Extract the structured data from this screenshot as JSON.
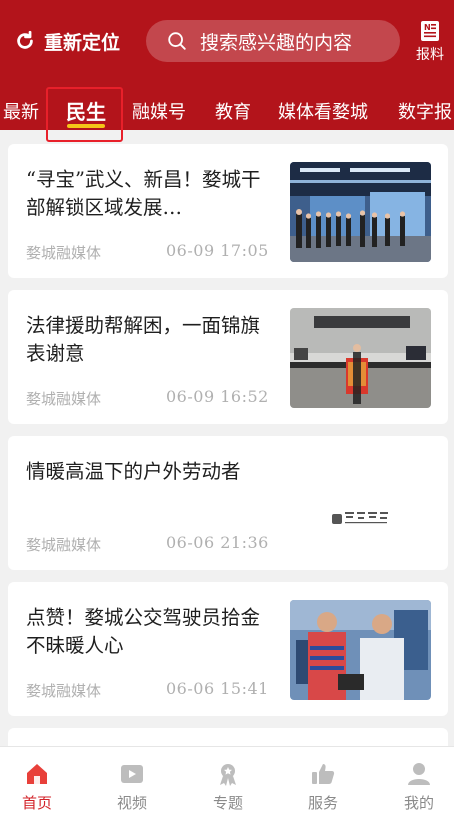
{
  "header": {
    "relocate_label": "重新定位",
    "search_placeholder": "搜索感兴趣的内容",
    "report_label": "报料"
  },
  "tabs": [
    {
      "label": "最新",
      "active": false
    },
    {
      "label": "民生",
      "active": true
    },
    {
      "label": "融媒号",
      "active": false
    },
    {
      "label": "教育",
      "active": false
    },
    {
      "label": "媒体看婺城",
      "active": false
    },
    {
      "label": "数字报",
      "active": false
    }
  ],
  "articles": [
    {
      "title": "“寻宝”武义、新昌！婺城干部解锁区域发展…",
      "source": "婺城融媒体",
      "time": "06-09 17:05",
      "thumb": "exhibition-hall-photo"
    },
    {
      "title": "法律援助帮解困，一面锦旗表谢意",
      "source": "婺城融媒体",
      "time": "06-09 16:52",
      "thumb": "banner-presentation-photo"
    },
    {
      "title": "情暖高温下的户外劳动者",
      "source": "婺城融媒体",
      "time": "06-06 21:36",
      "thumb": "calligraphy-logo"
    },
    {
      "title": "点赞！婺城公交驾驶员拾金不昧暖人心",
      "source": "婺城融媒体",
      "time": "06-06 15:41",
      "thumb": "bus-drivers-photo"
    }
  ],
  "bottom_nav": [
    {
      "label": "首页",
      "icon": "home-icon",
      "active": true
    },
    {
      "label": "视频",
      "icon": "video-icon",
      "active": false
    },
    {
      "label": "专题",
      "icon": "award-icon",
      "active": false
    },
    {
      "label": "服务",
      "icon": "thumbs-up-icon",
      "active": false
    },
    {
      "label": "我的",
      "icon": "user-icon",
      "active": false
    }
  ],
  "colors": {
    "brand_red": "#b3141b",
    "tab_underline": "#f5c518",
    "highlight_outline": "#e8202a",
    "active_nav": "#d3232a"
  }
}
